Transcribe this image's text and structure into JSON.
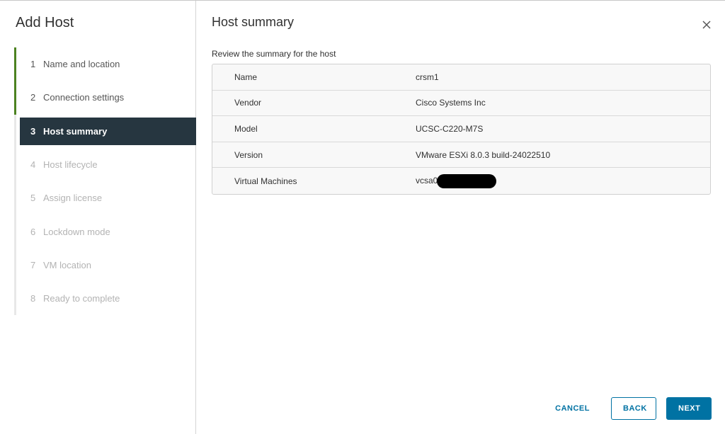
{
  "dialog": {
    "title": "Add Host",
    "close_icon": "close-icon"
  },
  "steps": [
    {
      "num": "1",
      "label": "Name and location",
      "state": "done"
    },
    {
      "num": "2",
      "label": "Connection settings",
      "state": "done"
    },
    {
      "num": "3",
      "label": "Host summary",
      "state": "current"
    },
    {
      "num": "4",
      "label": "Host lifecycle",
      "state": "pending"
    },
    {
      "num": "5",
      "label": "Assign license",
      "state": "pending"
    },
    {
      "num": "6",
      "label": "Lockdown mode",
      "state": "pending"
    },
    {
      "num": "7",
      "label": "VM location",
      "state": "pending"
    },
    {
      "num": "8",
      "label": "Ready to complete",
      "state": "pending"
    }
  ],
  "page": {
    "title": "Host summary",
    "description": "Review the summary for the host"
  },
  "summary": [
    {
      "key": "Name",
      "value": "crsm1"
    },
    {
      "key": "Vendor",
      "value": "Cisco Systems Inc"
    },
    {
      "key": "Model",
      "value": "UCSC-C220-M7S"
    },
    {
      "key": "Version",
      "value": "VMware ESXi 8.0.3 build-24022510"
    },
    {
      "key": "Virtual Machines",
      "value": "vcsa0",
      "redacted": true
    }
  ],
  "footer": {
    "cancel_label": "CANCEL",
    "back_label": "BACK",
    "next_label": "NEXT"
  },
  "colors": {
    "accent": "#0072a3",
    "step_done": "#4c8221",
    "step_current_bg": "#263640"
  }
}
